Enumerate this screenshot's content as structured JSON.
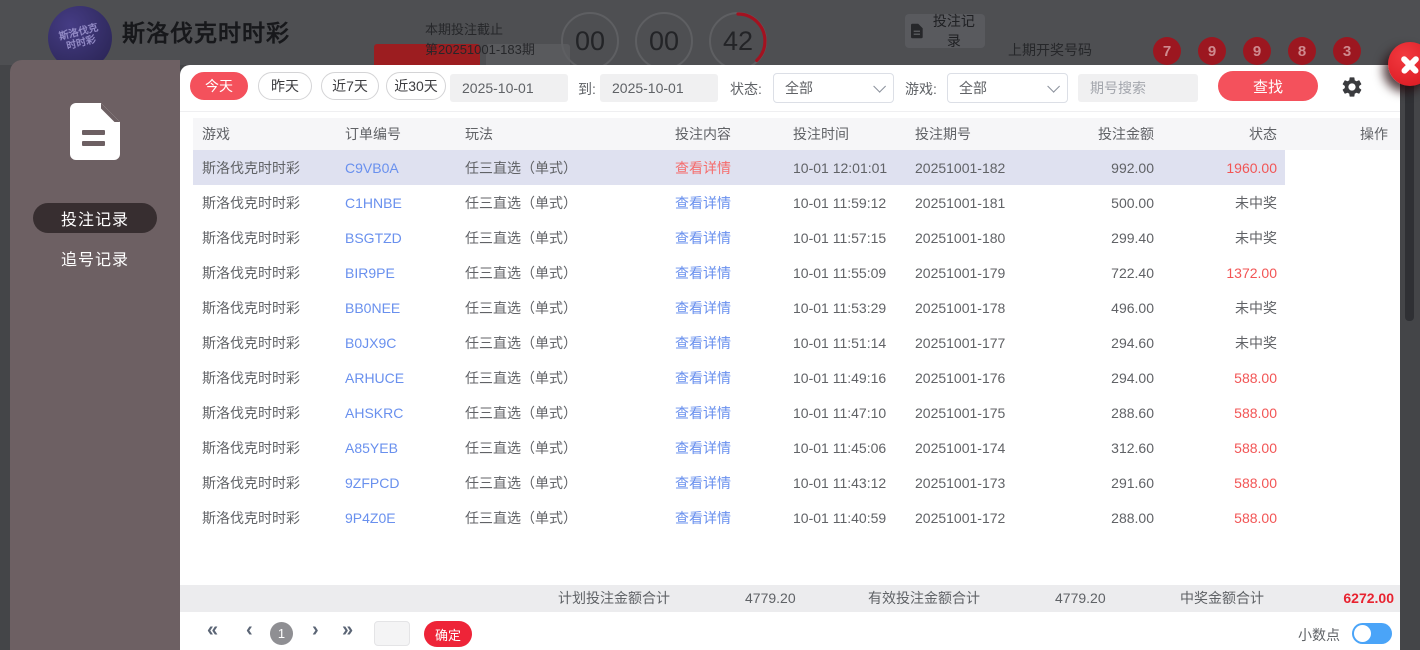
{
  "colors": {
    "accent_red": "#f4515c",
    "confirm_red": "#ee2438",
    "link_blue": "#6990ee",
    "win_red": "#f25555",
    "summary_win_red": "#e82330",
    "highlight_row": "#dfe1f0",
    "toggle_blue": "#4aa4f8",
    "ball_red": "#9c1720"
  },
  "icons": {
    "document": "document-icon",
    "gear": "gear-icon",
    "close": "close-x-icon",
    "chevron_down": "chevron-down-icon"
  },
  "overlay_header": {
    "logo_text": "斯洛伐克时时彩",
    "title": "斯洛伐克时时彩",
    "deadline_label": "本期投注截止",
    "period_label": "第20251001-183期",
    "countdown": [
      "00",
      "00",
      "42"
    ],
    "records_button": "投注记录",
    "last_draw_label": "上期开奖号码",
    "last_draw_numbers": [
      "7",
      "9",
      "9",
      "8",
      "3"
    ]
  },
  "sidebar": {
    "items": [
      {
        "label": "投注记录",
        "active": true
      },
      {
        "label": "追号记录",
        "active": false
      }
    ]
  },
  "modal": {
    "filters": {
      "quick_ranges": [
        "今天",
        "昨天",
        "近7天",
        "近30天"
      ],
      "active_range": "今天",
      "date_from": "2025-10-01",
      "to_label": "到:",
      "date_to": "2025-10-01",
      "status_label": "状态:",
      "status_value": "全部",
      "game_label": "游戏:",
      "game_value": "全部",
      "search_placeholder": "期号搜索",
      "search_button": "查找"
    },
    "table": {
      "columns": [
        "游戏",
        "订单编号",
        "玩法",
        "投注内容",
        "投注时间",
        "投注期号",
        "投注金额",
        "状态",
        "操作"
      ],
      "detail_link": "查看详情",
      "rows": [
        {
          "game": "斯洛伐克时时彩",
          "order": "C9VB0A",
          "play": "任三直选（单式）",
          "time": "10-01 12:01:01",
          "period": "20251001-182",
          "amount": "992.00",
          "status": "1960.00",
          "won": true,
          "highlight": true
        },
        {
          "game": "斯洛伐克时时彩",
          "order": "C1HNBE",
          "play": "任三直选（单式）",
          "time": "10-01 11:59:12",
          "period": "20251001-181",
          "amount": "500.00",
          "status": "未中奖",
          "won": false,
          "highlight": false
        },
        {
          "game": "斯洛伐克时时彩",
          "order": "BSGTZD",
          "play": "任三直选（单式）",
          "time": "10-01 11:57:15",
          "period": "20251001-180",
          "amount": "299.40",
          "status": "未中奖",
          "won": false,
          "highlight": false
        },
        {
          "game": "斯洛伐克时时彩",
          "order": "BIR9PE",
          "play": "任三直选（单式）",
          "time": "10-01 11:55:09",
          "period": "20251001-179",
          "amount": "722.40",
          "status": "1372.00",
          "won": true,
          "highlight": false
        },
        {
          "game": "斯洛伐克时时彩",
          "order": "BB0NEE",
          "play": "任三直选（单式）",
          "time": "10-01 11:53:29",
          "period": "20251001-178",
          "amount": "496.00",
          "status": "未中奖",
          "won": false,
          "highlight": false
        },
        {
          "game": "斯洛伐克时时彩",
          "order": "B0JX9C",
          "play": "任三直选（单式）",
          "time": "10-01 11:51:14",
          "period": "20251001-177",
          "amount": "294.60",
          "status": "未中奖",
          "won": false,
          "highlight": false
        },
        {
          "game": "斯洛伐克时时彩",
          "order": "ARHUCE",
          "play": "任三直选（单式）",
          "time": "10-01 11:49:16",
          "period": "20251001-176",
          "amount": "294.00",
          "status": "588.00",
          "won": true,
          "highlight": false
        },
        {
          "game": "斯洛伐克时时彩",
          "order": "AHSKRC",
          "play": "任三直选（单式）",
          "time": "10-01 11:47:10",
          "period": "20251001-175",
          "amount": "288.60",
          "status": "588.00",
          "won": true,
          "highlight": false
        },
        {
          "game": "斯洛伐克时时彩",
          "order": "A85YEB",
          "play": "任三直选（单式）",
          "time": "10-01 11:45:06",
          "period": "20251001-174",
          "amount": "312.60",
          "status": "588.00",
          "won": true,
          "highlight": false
        },
        {
          "game": "斯洛伐克时时彩",
          "order": "9ZFPCD",
          "play": "任三直选（单式）",
          "time": "10-01 11:43:12",
          "period": "20251001-173",
          "amount": "291.60",
          "status": "588.00",
          "won": true,
          "highlight": false
        },
        {
          "game": "斯洛伐克时时彩",
          "order": "9P4Z0E",
          "play": "任三直选（单式）",
          "time": "10-01 11:40:59",
          "period": "20251001-172",
          "amount": "288.00",
          "status": "588.00",
          "won": true,
          "highlight": false
        }
      ]
    },
    "summary": {
      "plan_label": "计划投注金额合计",
      "plan_value": "4779.20",
      "valid_label": "有效投注金额合计",
      "valid_value": "4779.20",
      "win_label": "中奖金额合计",
      "win_value": "6272.00"
    },
    "pagination": {
      "current_page": "1",
      "page_input_value": "",
      "confirm_label": "确定",
      "decimal_label": "小数点",
      "decimal_toggle_on": true
    }
  }
}
